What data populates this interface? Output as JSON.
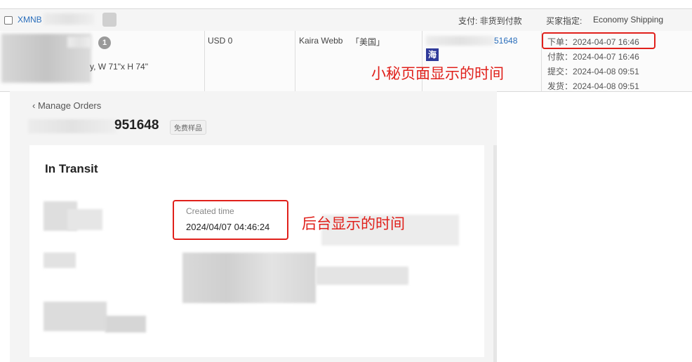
{
  "order_table": {
    "order_id_prefix": "XMNB",
    "payment_label": "支付: 非货到付款",
    "shipping_label": "买家指定:",
    "shipping_value": "Economy Shipping",
    "item_count": "1",
    "item_desc_visible": "y, W 71\"x H 74\"",
    "amount": "USD 0",
    "buyer_name": "Kaira Webb",
    "buyer_country": "「美国」",
    "order_number_suffix": "51648",
    "hai_badge": "海",
    "times": [
      {
        "label": "下单",
        "value": "2024-04-07 16:46"
      },
      {
        "label": "付款",
        "value": "2024-04-07 16:46"
      },
      {
        "label": "提交",
        "value": "2024-04-08 09:51"
      },
      {
        "label": "发货",
        "value": "2024-04-08 09:51"
      }
    ]
  },
  "annotations": {
    "top": "小秘页面显示的时间",
    "bottom": "后台显示的时间"
  },
  "order_detail": {
    "back_link": "‹ Manage Orders",
    "order_number_visible": "951648",
    "sample_tag": "免费样品",
    "status": "In Transit",
    "created_time_label": "Created time",
    "created_time_value": "2024/04/07 04:46:24"
  },
  "colors": {
    "highlight_red": "#e0201b",
    "link_blue": "#2a6ebb",
    "hai_badge_bg": "#2f3a9a"
  }
}
